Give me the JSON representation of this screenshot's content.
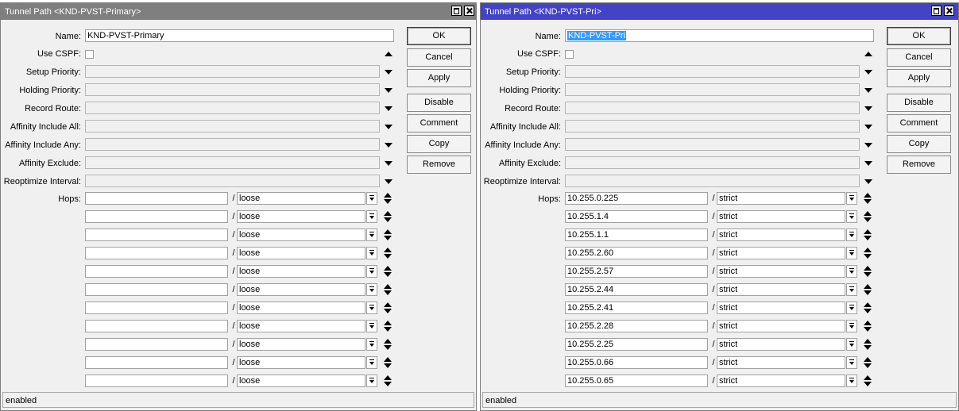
{
  "windows": [
    {
      "title": "Tunnel Path <KND-PVST-Primary>",
      "fields": {
        "name_label": "Name:",
        "name_value": "KND-PVST-Primary",
        "use_cspf_label": "Use CSPF:",
        "setup_priority_label": "Setup Priority:",
        "holding_priority_label": "Holding Priority:",
        "record_route_label": "Record Route:",
        "affinity_include_all_label": "Affinity Include All:",
        "affinity_include_any_label": "Affinity Include Any:",
        "affinity_exclude_label": "Affinity Exclude:",
        "reoptimize_interval_label": "Reoptimize Interval:",
        "hops_label": "Hops:"
      },
      "hops": [
        {
          "address": "",
          "sep": "/",
          "type": "loose"
        },
        {
          "address": "",
          "sep": "/",
          "type": "loose"
        },
        {
          "address": "",
          "sep": "/",
          "type": "loose"
        },
        {
          "address": "",
          "sep": "/",
          "type": "loose"
        },
        {
          "address": "",
          "sep": "/",
          "type": "loose"
        },
        {
          "address": "",
          "sep": "/",
          "type": "loose"
        },
        {
          "address": "",
          "sep": "/",
          "type": "loose"
        },
        {
          "address": "",
          "sep": "/",
          "type": "loose"
        },
        {
          "address": "",
          "sep": "/",
          "type": "loose"
        },
        {
          "address": "",
          "sep": "/",
          "type": "loose"
        },
        {
          "address": "",
          "sep": "/",
          "type": "loose"
        }
      ],
      "buttons": {
        "ok": "OK",
        "cancel": "Cancel",
        "apply": "Apply",
        "disable": "Disable",
        "comment": "Comment",
        "copy": "Copy",
        "remove": "Remove"
      },
      "status": "enabled"
    },
    {
      "title": "Tunnel Path <KND-PVST-Pri>",
      "fields": {
        "name_label": "Name:",
        "name_value": "KND-PVST-Pri",
        "use_cspf_label": "Use CSPF:",
        "setup_priority_label": "Setup Priority:",
        "holding_priority_label": "Holding Priority:",
        "record_route_label": "Record Route:",
        "affinity_include_all_label": "Affinity Include All:",
        "affinity_include_any_label": "Affinity Include Any:",
        "affinity_exclude_label": "Affinity Exclude:",
        "reoptimize_interval_label": "Reoptimize Interval:",
        "hops_label": "Hops:"
      },
      "hops": [
        {
          "address": "10.255.0.225",
          "sep": "/",
          "type": "strict"
        },
        {
          "address": "10.255.1.4",
          "sep": "/",
          "type": "strict"
        },
        {
          "address": "10.255.1.1",
          "sep": "/",
          "type": "strict"
        },
        {
          "address": "10.255.2.60",
          "sep": "/",
          "type": "strict"
        },
        {
          "address": "10.255.2.57",
          "sep": "/",
          "type": "strict"
        },
        {
          "address": "10.255.2.44",
          "sep": "/",
          "type": "strict"
        },
        {
          "address": "10.255.2.41",
          "sep": "/",
          "type": "strict"
        },
        {
          "address": "10.255.2.28",
          "sep": "/",
          "type": "strict"
        },
        {
          "address": "10.255.2.25",
          "sep": "/",
          "type": "strict"
        },
        {
          "address": "10.255.0.66",
          "sep": "/",
          "type": "strict"
        },
        {
          "address": "10.255.0.65",
          "sep": "/",
          "type": "strict"
        }
      ],
      "buttons": {
        "ok": "OK",
        "cancel": "Cancel",
        "apply": "Apply",
        "disable": "Disable",
        "comment": "Comment",
        "copy": "Copy",
        "remove": "Remove"
      },
      "status": "enabled"
    }
  ],
  "colors": {
    "inactive_titlebar": "#7f7f7f",
    "active_titlebar": "#4343c8",
    "selection": "#3399ff",
    "window_bg": "#f0f0f0"
  }
}
